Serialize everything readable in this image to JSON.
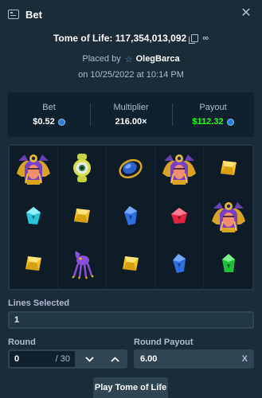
{
  "header": {
    "title": "Bet",
    "icon": "receipt-icon",
    "close_icon": "close-icon"
  },
  "bet_info": {
    "game_name": "Tome of Life",
    "separator": ":",
    "bet_id": "117,354,013,092",
    "placed_by_label": "Placed by",
    "user": "OlegBarca",
    "date": "on 10/25/2022 at 10:14 PM"
  },
  "stats": {
    "bet_label": "Bet",
    "bet_value": "$0.52",
    "multiplier_label": "Multiplier",
    "multiplier_value": "216.00×",
    "payout_label": "Payout",
    "payout_value": "$112.32",
    "payout_color": "#1fff20",
    "coin_icon": "litecoin-icon"
  },
  "grid": {
    "cells": [
      "pharaoh-icon",
      "scarab-eye-icon",
      "blue-beetle-icon",
      "pharaoh-icon",
      "yellow-gem-icon",
      "cyan-gem-icon",
      "yellow-gem-icon",
      "blue-gem-icon",
      "red-gem-icon",
      "pharaoh-icon",
      "yellow-gem-icon",
      "purple-creature-icon",
      "yellow-gem-icon",
      "blue-gem-icon",
      "green-gem-icon"
    ]
  },
  "form": {
    "lines_selected_label": "Lines Selected",
    "lines_selected_value": "1",
    "round_label": "Round",
    "round_value": "0",
    "round_total": "/ 30",
    "round_payout_label": "Round Payout",
    "round_payout_value": "6.00",
    "clear_label": "X"
  },
  "play_button_label": "Play Tome of Life"
}
